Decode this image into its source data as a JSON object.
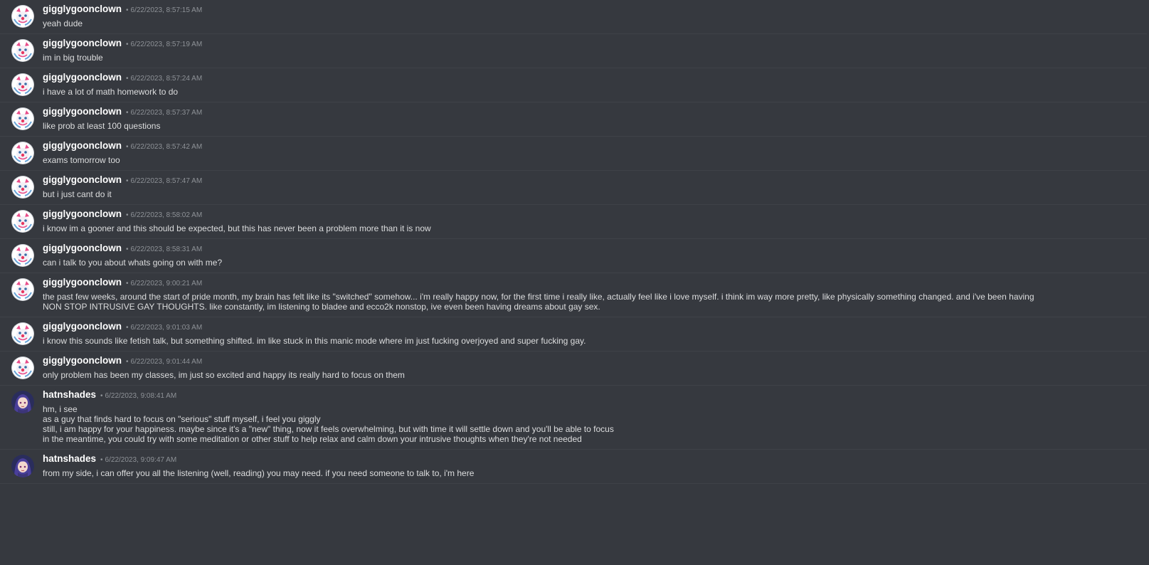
{
  "users": {
    "gigglygoonclown": {
      "name": "gigglygoonclown",
      "avatar_icon": "clown-avatar-icon"
    },
    "hatnshades": {
      "name": "hatnshades",
      "avatar_icon": "anime-girl-avatar-icon"
    }
  },
  "colors": {
    "background": "#36393f",
    "username": "#ffffff",
    "message_text": "#dcddde",
    "timestamp": "#8e9297",
    "divider": "#3f4248"
  },
  "separator": "•",
  "messages": [
    {
      "user": "gigglygoonclown",
      "timestamp": "6/22/2023, 8:57:15 AM",
      "lines": [
        "yeah dude"
      ]
    },
    {
      "user": "gigglygoonclown",
      "timestamp": "6/22/2023, 8:57:19 AM",
      "lines": [
        "im in big trouble"
      ]
    },
    {
      "user": "gigglygoonclown",
      "timestamp": "6/22/2023, 8:57:24 AM",
      "lines": [
        "i have a lot of math homework to do"
      ]
    },
    {
      "user": "gigglygoonclown",
      "timestamp": "6/22/2023, 8:57:37 AM",
      "lines": [
        "like prob at least 100 questions"
      ]
    },
    {
      "user": "gigglygoonclown",
      "timestamp": "6/22/2023, 8:57:42 AM",
      "lines": [
        "exams tomorrow too"
      ]
    },
    {
      "user": "gigglygoonclown",
      "timestamp": "6/22/2023, 8:57:47 AM",
      "lines": [
        "but i just cant do it"
      ]
    },
    {
      "user": "gigglygoonclown",
      "timestamp": "6/22/2023, 8:58:02 AM",
      "lines": [
        "i know im a gooner and this should be expected, but this has never been a problem more than it is now"
      ]
    },
    {
      "user": "gigglygoonclown",
      "timestamp": "6/22/2023, 8:58:31 AM",
      "lines": [
        "can i talk to you about whats going on with me?"
      ]
    },
    {
      "user": "gigglygoonclown",
      "timestamp": "6/22/2023, 9:00:21 AM",
      "lines": [
        "the past few weeks, around the start of pride month, my brain has felt like its \"switched\" somehow... i'm really happy now, for the first time i really like, actually feel like i love myself. i think im way more pretty, like physically something changed. and i've been having",
        "NON STOP INTRUSIVE GAY THOUGHTS. like constantly, im listening to bladee and ecco2k nonstop, ive even been having dreams about gay sex."
      ]
    },
    {
      "user": "gigglygoonclown",
      "timestamp": "6/22/2023, 9:01:03 AM",
      "lines": [
        "i know this sounds like fetish talk, but something shifted. im like stuck in this manic mode where im just fucking overjoyed and super fucking gay."
      ]
    },
    {
      "user": "gigglygoonclown",
      "timestamp": "6/22/2023, 9:01:44 AM",
      "lines": [
        "only problem has been my classes, im just so excited and happy its really hard to focus on them"
      ]
    },
    {
      "user": "hatnshades",
      "timestamp": "6/22/2023, 9:08:41 AM",
      "lines": [
        "hm, i see",
        "as a guy that finds hard to focus on \"serious\" stuff myself, i feel you giggly",
        "still, i am happy for your happiness. maybe since it's a \"new\" thing, now it feels overwhelming, but with time it will settle down and you'll be able to focus",
        "in the meantime, you could try with some meditation or other stuff to help relax and calm down your intrusive thoughts when they're not needed"
      ]
    },
    {
      "user": "hatnshades",
      "timestamp": "6/22/2023, 9:09:47 AM",
      "lines": [
        "from my side, i can offer you all the listening (well, reading) you may need. if you need someone to talk to, i'm here"
      ]
    }
  ]
}
